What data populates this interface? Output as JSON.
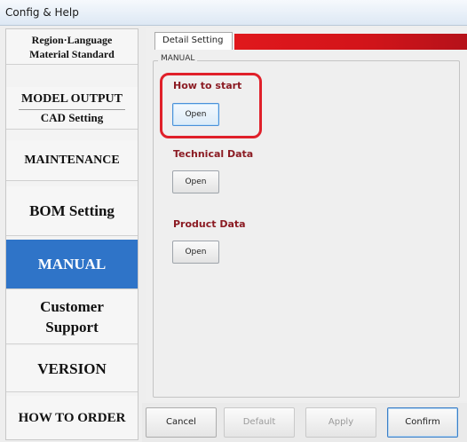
{
  "window": {
    "title": "Config & Help"
  },
  "sidebar": {
    "items": [
      {
        "lines": [
          "Region·Language",
          "Material Standard"
        ],
        "active": false
      },
      {
        "lines": [
          "MODEL OUTPUT",
          "CAD Setting"
        ],
        "active": false
      },
      {
        "lines": [
          "MAINTENANCE"
        ],
        "active": false
      },
      {
        "lines": [
          "BOM Setting"
        ],
        "active": false
      },
      {
        "lines": [
          "MANUAL"
        ],
        "active": true
      },
      {
        "lines": [
          "Customer",
          "Support"
        ],
        "active": false
      },
      {
        "lines": [
          "VERSION"
        ],
        "active": false
      },
      {
        "lines": [
          "HOW TO ORDER"
        ],
        "active": false
      }
    ]
  },
  "panel": {
    "tab_label": "Detail Setting",
    "group_label": "MANUAL",
    "sections": [
      {
        "title": "How to start",
        "button": "Open",
        "highlighted": true
      },
      {
        "title": "Technical Data",
        "button": "Open",
        "highlighted": false
      },
      {
        "title": "Product Data",
        "button": "Open",
        "highlighted": false
      }
    ]
  },
  "footer": {
    "cancel": "Cancel",
    "default": "Default",
    "apply": "Apply",
    "confirm": "Confirm"
  },
  "colors": {
    "active_sidebar": "#2f74c8",
    "section_title": "#8b1b23",
    "tab_accent": "#e0181c",
    "highlight": "#e0202a"
  }
}
